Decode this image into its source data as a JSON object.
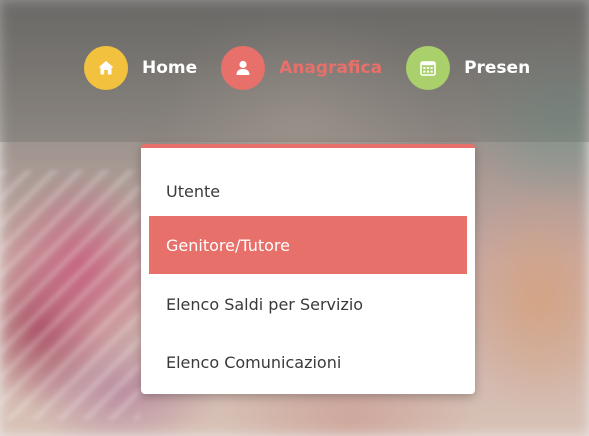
{
  "nav": {
    "items": [
      {
        "label": "Home",
        "icon": "home-icon",
        "color": "#f2c13e",
        "active": false
      },
      {
        "label": "Anagrafica",
        "icon": "user-icon",
        "color": "#e8706a",
        "active": true
      },
      {
        "label": "Presen",
        "icon": "calendar-icon",
        "color": "#a9d06a",
        "active": false
      }
    ]
  },
  "dropdown": {
    "accent": "#e8706a",
    "items": [
      {
        "label": "Utente",
        "active": false
      },
      {
        "label": "Genitore/Tutore",
        "active": true
      },
      {
        "label": "Elenco Saldi per Servizio",
        "active": false
      },
      {
        "label": "Elenco Comunicazioni",
        "active": false
      }
    ]
  }
}
